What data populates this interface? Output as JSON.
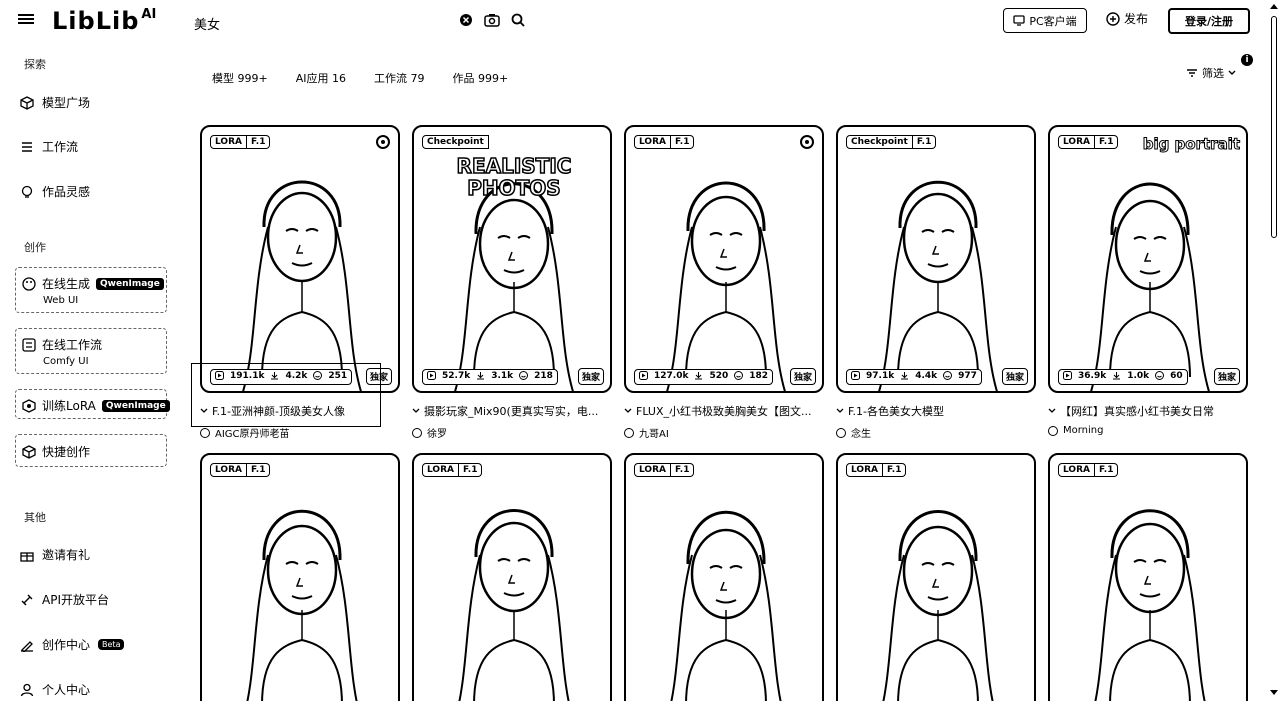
{
  "header": {
    "logo_text": "LibLib",
    "logo_sup": "AI",
    "search_value": "美女",
    "pc_client_label": "PC客户端",
    "publish_label": "发布",
    "login_label": "登录/注册"
  },
  "sidebar": {
    "explore_title": "探索",
    "explore_items": [
      {
        "label": "模型广场",
        "icon": "cube-icon"
      },
      {
        "label": "工作流",
        "icon": "workflow-icon"
      },
      {
        "label": "作品灵感",
        "icon": "bulb-icon"
      }
    ],
    "create_title": "创作",
    "create_items": [
      {
        "label": "在线生成",
        "badge": "QwenImage",
        "sub": "Web UI",
        "icon": "palette-icon"
      },
      {
        "label": "在线工作流",
        "sub": "Comfy UI",
        "icon": "flow-icon"
      },
      {
        "label": "训练LoRA",
        "badge": "QwenImage",
        "icon": "train-icon"
      },
      {
        "label": "快捷创作",
        "icon": "quick-icon"
      }
    ],
    "other_title": "其他",
    "other_items": [
      {
        "label": "邀请有礼",
        "icon": "gift-icon"
      },
      {
        "label": "API开放平台",
        "icon": "api-icon"
      },
      {
        "label": "创作中心",
        "badge": "Beta",
        "icon": "studio-icon"
      },
      {
        "label": "个人中心",
        "icon": "user-icon"
      }
    ]
  },
  "tabs": [
    {
      "label": "模型 999+"
    },
    {
      "label": "AI应用 16"
    },
    {
      "label": "工作流 79"
    },
    {
      "label": "作品 999+"
    }
  ],
  "filter_label": "筛选",
  "cards_row1": [
    {
      "type": "LORA",
      "base": "F.1",
      "runs": "191.1k",
      "downloads": "4.2k",
      "likes": "251",
      "exclusive": "独家",
      "title": "F.1-亚洲神颜-顶级美女人像",
      "author": "AIGC原丹师老苗"
    },
    {
      "type": "Checkpoint",
      "base": "",
      "overlay": "REALISTIC PHOTOS",
      "runs": "52.7k",
      "downloads": "3.1k",
      "likes": "218",
      "exclusive": "独家",
      "title": "摄影玩家_Mix90(更真实写实，电...",
      "author": "徐罗"
    },
    {
      "type": "LORA",
      "base": "F.1",
      "runs": "127.0k",
      "downloads": "520",
      "likes": "182",
      "exclusive": "独家",
      "title": "FLUX_小红书极致美胸美女【图文...",
      "author": "九哥AI"
    },
    {
      "type": "Checkpoint",
      "base": "F.1",
      "runs": "97.1k",
      "downloads": "4.4k",
      "likes": "977",
      "exclusive": "独家",
      "title": "F.1-各色美女大模型",
      "author": "念生"
    },
    {
      "type": "LORA",
      "base": "F.1",
      "overlay_small": "big portrait",
      "runs": "36.9k",
      "downloads": "1.0k",
      "likes": "60",
      "exclusive": "独家",
      "title": "【网红】真实感小红书美女日常",
      "author": "Morning"
    }
  ],
  "cards_row2": [
    {
      "type": "LORA",
      "base": "F.1"
    },
    {
      "type": "LORA",
      "base": "F.1"
    },
    {
      "type": "LORA",
      "base": "F.1"
    },
    {
      "type": "LORA",
      "base": "F.1"
    },
    {
      "type": "LORA",
      "base": "F.1"
    }
  ]
}
